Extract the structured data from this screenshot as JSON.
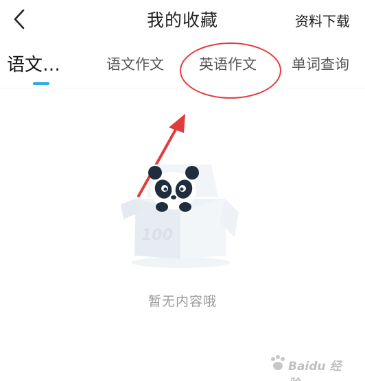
{
  "header": {
    "title": "我的收藏",
    "action_label": "资料下载",
    "back_icon": "chevron-left-icon"
  },
  "tabs": [
    {
      "label": "语文…",
      "active": true
    },
    {
      "label": "语文作文",
      "active": false
    },
    {
      "label": "英语作文",
      "active": false
    },
    {
      "label": "单词查询",
      "active": false
    }
  ],
  "empty_state": {
    "message": "暂无内容哦",
    "illustration_icon": "panda-in-box-icon",
    "box_label": "100"
  },
  "watermark": {
    "text": "Baidu 经验"
  },
  "colors": {
    "accent": "#2fa8f0",
    "annotation": "#e23b3b",
    "muted_text": "#9a9a9a"
  }
}
